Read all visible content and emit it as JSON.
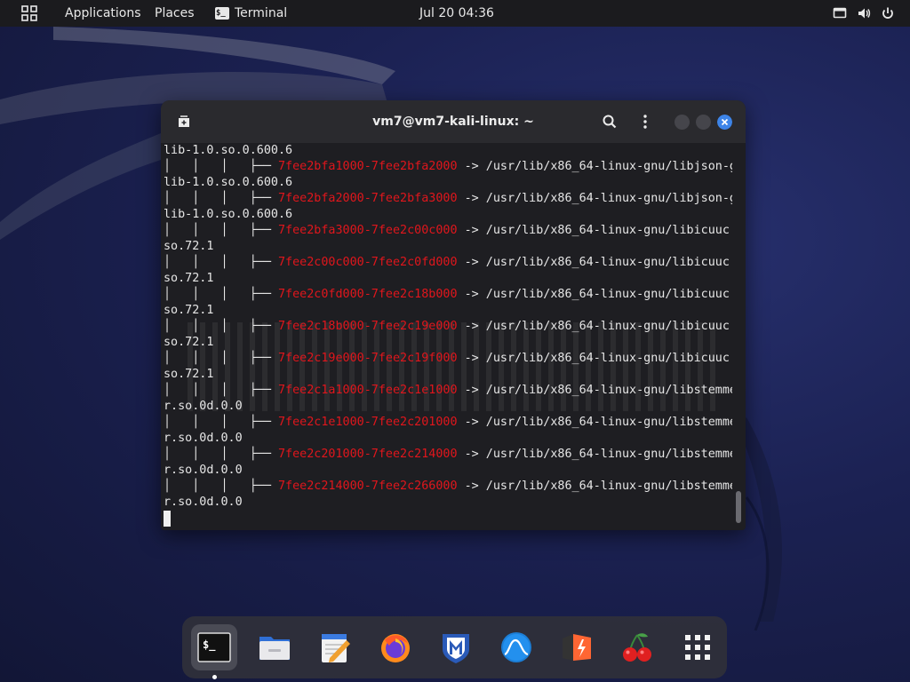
{
  "topbar": {
    "applications": "Applications",
    "places": "Places",
    "terminal": "Terminal",
    "clock": "Jul 20  04:36",
    "terminal_icon_glyph": "$_"
  },
  "window": {
    "title": "vm7@vm7-kali-linux: ~"
  },
  "terminal_lines": [
    {
      "pre": "lib-1.0.so.0.600.6",
      "addr": "",
      "post": ""
    },
    {
      "pre": "│   │   │   ├── ",
      "addr": "7fee2bfa1000-7fee2bfa2000",
      "post": " -> /usr/lib/x86_64-linux-gnu/libjson-g"
    },
    {
      "pre": "lib-1.0.so.0.600.6",
      "addr": "",
      "post": ""
    },
    {
      "pre": "│   │   │   ├── ",
      "addr": "7fee2bfa2000-7fee2bfa3000",
      "post": " -> /usr/lib/x86_64-linux-gnu/libjson-g"
    },
    {
      "pre": "lib-1.0.so.0.600.6",
      "addr": "",
      "post": ""
    },
    {
      "pre": "│   │   │   ├── ",
      "addr": "7fee2bfa3000-7fee2c00c000",
      "post": " -> /usr/lib/x86_64-linux-gnu/libicuuc."
    },
    {
      "pre": "so.72.1",
      "addr": "",
      "post": ""
    },
    {
      "pre": "│   │   │   ├── ",
      "addr": "7fee2c00c000-7fee2c0fd000",
      "post": " -> /usr/lib/x86_64-linux-gnu/libicuuc."
    },
    {
      "pre": "so.72.1",
      "addr": "",
      "post": ""
    },
    {
      "pre": "│   │   │   ├── ",
      "addr": "7fee2c0fd000-7fee2c18b000",
      "post": " -> /usr/lib/x86_64-linux-gnu/libicuuc."
    },
    {
      "pre": "so.72.1",
      "addr": "",
      "post": ""
    },
    {
      "pre": "│   │   │   ├── ",
      "addr": "7fee2c18b000-7fee2c19e000",
      "post": " -> /usr/lib/x86_64-linux-gnu/libicuuc."
    },
    {
      "pre": "so.72.1",
      "addr": "",
      "post": ""
    },
    {
      "pre": "│   │   │   ├── ",
      "addr": "7fee2c19e000-7fee2c19f000",
      "post": " -> /usr/lib/x86_64-linux-gnu/libicuuc."
    },
    {
      "pre": "so.72.1",
      "addr": "",
      "post": ""
    },
    {
      "pre": "│   │   │   ├── ",
      "addr": "7fee2c1a1000-7fee2c1e1000",
      "post": " -> /usr/lib/x86_64-linux-gnu/libstemme"
    },
    {
      "pre": "r.so.0d.0.0",
      "addr": "",
      "post": ""
    },
    {
      "pre": "│   │   │   ├── ",
      "addr": "7fee2c1e1000-7fee2c201000",
      "post": " -> /usr/lib/x86_64-linux-gnu/libstemme"
    },
    {
      "pre": "r.so.0d.0.0",
      "addr": "",
      "post": ""
    },
    {
      "pre": "│   │   │   ├── ",
      "addr": "7fee2c201000-7fee2c214000",
      "post": " -> /usr/lib/x86_64-linux-gnu/libstemme"
    },
    {
      "pre": "r.so.0d.0.0",
      "addr": "",
      "post": ""
    },
    {
      "pre": "│   │   │   ├── ",
      "addr": "7fee2c214000-7fee2c266000",
      "post": " -> /usr/lib/x86_64-linux-gnu/libstemme"
    },
    {
      "pre": "r.so.0d.0.0",
      "addr": "",
      "post": ""
    }
  ],
  "colors": {
    "address": "#e0161c",
    "close_button": "#3d84e8"
  },
  "icons": {
    "activities": "grid-icon",
    "new_tab": "new-tab-icon",
    "search": "search-icon",
    "menu": "kebab-menu-icon",
    "minimize": "minimize-icon",
    "maximize": "maximize-icon",
    "close": "close-icon",
    "screen": "display-icon",
    "volume": "volume-icon",
    "power": "power-icon"
  },
  "dock": [
    {
      "name": "terminal",
      "icon": "terminal-icon",
      "active": true
    },
    {
      "name": "files",
      "icon": "folder-icon",
      "active": false
    },
    {
      "name": "text-editor",
      "icon": "text-editor-icon",
      "active": false
    },
    {
      "name": "firefox",
      "icon": "firefox-icon",
      "active": false
    },
    {
      "name": "metasploit",
      "icon": "metasploit-icon",
      "active": false
    },
    {
      "name": "wireshark",
      "icon": "wireshark-icon",
      "active": false
    },
    {
      "name": "burpsuite",
      "icon": "burpsuite-icon",
      "active": false
    },
    {
      "name": "cherrytree",
      "icon": "cherrytree-icon",
      "active": false
    },
    {
      "name": "show-apps",
      "icon": "app-grid-icon",
      "active": false
    }
  ]
}
